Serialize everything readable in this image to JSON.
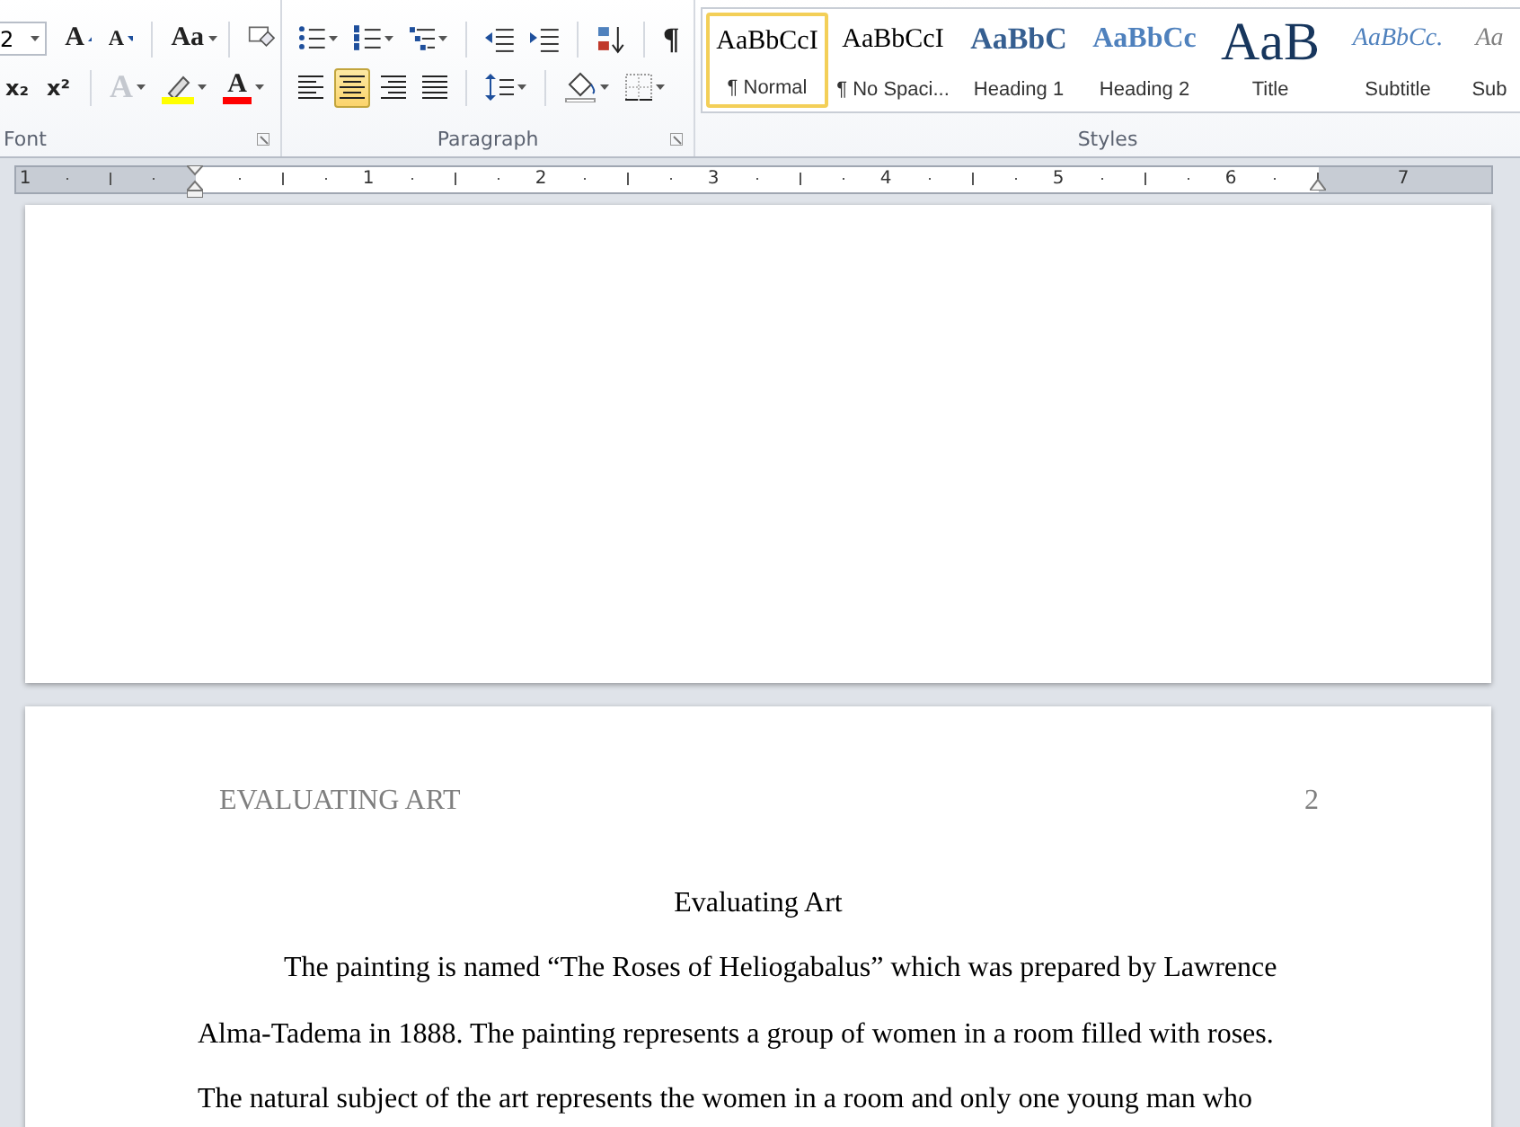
{
  "ribbon": {
    "font_group": {
      "label": "Font",
      "font_size": "2",
      "grow_glyph": "A",
      "shrink_glyph": "A",
      "case_glyph": "Aa",
      "subscript_glyph": "x₂",
      "superscript_glyph": "x²",
      "effects": {
        "glyph": "A",
        "disabled": true
      },
      "font_color_glyph": "A"
    },
    "paragraph_group": {
      "label": "Paragraph",
      "pilcrow": "¶",
      "alignments": [
        {
          "selected": false
        },
        {
          "selected": true
        },
        {
          "selected": false
        },
        {
          "selected": false
        }
      ]
    },
    "styles_group": {
      "label": "Styles",
      "styles": [
        {
          "kind": "normal",
          "preview": "AaBbCcI",
          "name": "¶ Normal",
          "selected": true
        },
        {
          "kind": "normal",
          "preview": "AaBbCcI",
          "name": "¶ No Spaci...",
          "selected": false
        },
        {
          "kind": "heading1",
          "preview": "AaBbC",
          "name": "Heading 1",
          "selected": false
        },
        {
          "kind": "heading2",
          "preview": "AaBbCc",
          "name": "Heading 2",
          "selected": false
        },
        {
          "kind": "title",
          "preview": "AaB",
          "name": "Title",
          "selected": false
        },
        {
          "kind": "subtitle",
          "preview": "AaBbCc.",
          "name": "Subtitle",
          "selected": false
        },
        {
          "kind": "subtle",
          "preview": "Aa",
          "name": "Sub",
          "selected": false
        }
      ]
    }
  },
  "ruler": {
    "labels": [
      "1",
      "1",
      "2",
      "3",
      "4",
      "5",
      "6",
      "7"
    ]
  },
  "document": {
    "header": {
      "title": "EVALUATING ART",
      "page_number": "2"
    },
    "title": "Evaluating Art",
    "paragraph_lines": [
      "The painting is named “The Roses of Heliogabalus” which was prepared by Lawrence",
      "Alma-Tadema in 1888. The painting represents a group of women in a room filled with roses.",
      "The natural subject of the art represents the women in a room and only one young man who"
    ]
  }
}
